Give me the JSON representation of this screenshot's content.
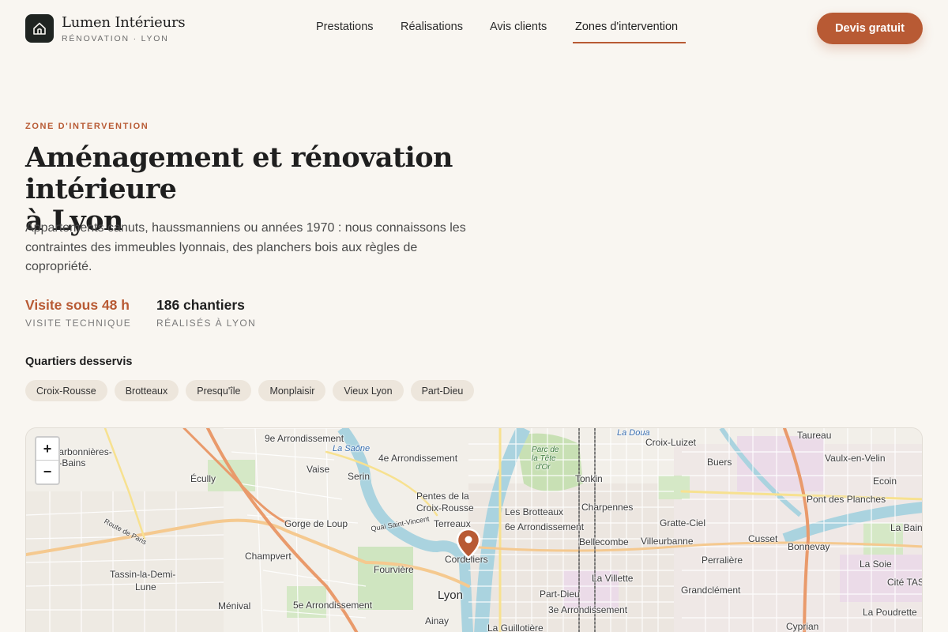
{
  "header": {
    "brand_name": "Lumen Intérieurs",
    "brand_sub": "RÉNOVATION · LYON",
    "nav": [
      "Prestations",
      "Réalisations",
      "Avis clients",
      "Zones d'intervention"
    ],
    "active_nav": "Zones d'intervention",
    "cta": "Devis gratuit"
  },
  "hero": {
    "eyebrow": "ZONE D'INTERVENTION",
    "title_line1": "Aménagement et rénovation intérieure",
    "title_line2": "à Lyon",
    "lead": "Appartements canuts, haussmanniens ou années 1970 : nous connaissons les contraintes des immeubles lyonnais, des planchers bois aux règles de copropriété.",
    "stats": [
      {
        "value": "Visite sous 48 h",
        "label": "VISITE TECHNIQUE"
      },
      {
        "value": "186 chantiers",
        "label": "RÉALISÉS À LYON"
      }
    ],
    "quartiers_title": "Quartiers desservis",
    "quartiers": [
      "Croix-Rousse",
      "Brotteaux",
      "Presqu'île",
      "Monplaisir",
      "Vieux Lyon",
      "Part-Dieu"
    ]
  },
  "map": {
    "zoom_in": "+",
    "zoom_out": "−",
    "labels": {
      "arr9": "9e Arrondissement",
      "arr4": "4e Arrondissement",
      "arr6": "6e Arrondissement",
      "arr5": "5e Arrondissement",
      "arr3": "3e Arrondissement",
      "croix_luizet": "Croix-Luizet",
      "taureau": "Taureau",
      "vaulx": "Vaulx-en-Velin",
      "ecully": "Écully",
      "vaise": "Vaise",
      "serin": "Serin",
      "tonkin": "Tonkin",
      "buers": "Buers",
      "ecoin": "Ecoin",
      "pentes1": "Pentes de la",
      "pentes2": "Croix-Rousse",
      "brotteaux": "Les Brotteaux",
      "charpennes": "Charpennes",
      "pont_planches": "Pont des Planches",
      "gorge": "Gorge de Loup",
      "terreaux": "Terreaux",
      "gratte_ciel": "Gratte-Ciel",
      "la_bain": "La Bain",
      "bellecombe": "Bellecombe",
      "villeurbanne": "Villeurbanne",
      "cusset": "Cusset",
      "bonnevay": "Bonnevay",
      "champvert": "Champvert",
      "cordeliers": "Cordeliers",
      "fourviere": "Fourvière",
      "perraliere": "Perralière",
      "la_soie": "La Soie",
      "tassin1": "Tassin-la-Demi-",
      "tassin2": "Lune",
      "la_villette": "La Villette",
      "part_dieu": "Part-Dieu",
      "lyon": "Lyon",
      "grandclement": "Grandclément",
      "cite_tase": "Cité TASE",
      "menival": "Ménival",
      "ainay": "Ainay",
      "guillotiere": "La Guillotière",
      "poudrette": "La Poudrette",
      "cyprian": "Cyprian",
      "charbonnieres1": "Charbonnières-",
      "charbonnieres2": "les-Bains",
      "la_saone": "La Saône",
      "la_doua": "La Doua",
      "parc1": "Parc de",
      "parc2": "la Tête",
      "parc3": "d'Or",
      "route_paris": "Route de Paris",
      "quai_vincent": "Quai Saint-Vincent"
    }
  }
}
